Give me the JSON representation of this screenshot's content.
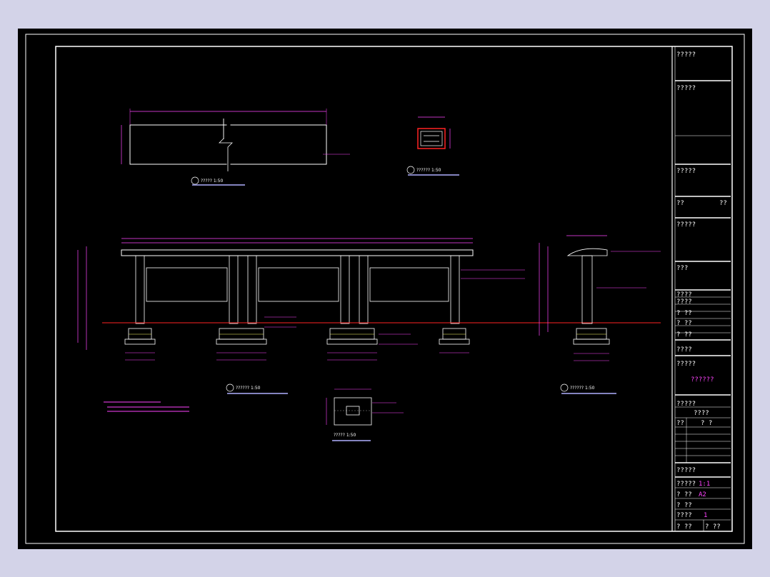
{
  "colors": {
    "background": "#d3d3e8",
    "sheet": "#000000",
    "frame": "#ffffff",
    "dimension": "#ff44ff",
    "ground_line": "#ff2222",
    "hatch": "#ffff66",
    "title_underline": "#b0b0ff",
    "title_value": "#ff44ff"
  },
  "views": [
    {
      "title": "????? 1:50"
    },
    {
      "title": "?????? 1:50"
    },
    {
      "title": "?????? 1:50"
    },
    {
      "title": "?????? 1:50"
    },
    {
      "title": "????? 1:50"
    }
  ],
  "title_block": {
    "rows": [
      {
        "label": "?????"
      },
      {
        "label": "?????"
      },
      {
        "label": "?????"
      },
      {
        "label": "??",
        "value": "??"
      },
      {
        "label": "?????"
      },
      {
        "label": "???"
      },
      {
        "label": "????"
      },
      {
        "label": "????"
      },
      {
        "label": "? ??"
      },
      {
        "label": "? ??"
      },
      {
        "label": "? ??"
      },
      {
        "label": "????"
      },
      {
        "label": "?????",
        "value": "??????"
      },
      {
        "label": "?????",
        "value": "????"
      },
      {
        "label": "??",
        "value": "? ?"
      },
      {
        "label": "?????"
      },
      {
        "label": "?????",
        "value": "1:1"
      },
      {
        "label": "? ??",
        "value": "A2"
      },
      {
        "label": "? ??"
      },
      {
        "label": "????",
        "value": "1"
      },
      {
        "label": "? ??",
        "value": "? ??"
      }
    ]
  }
}
